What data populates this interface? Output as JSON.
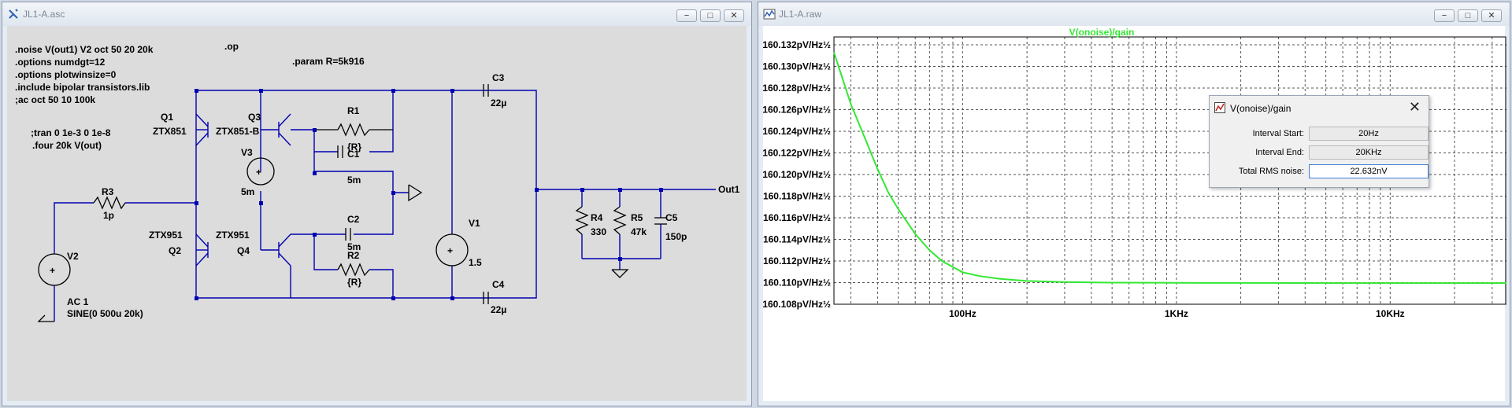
{
  "schematic_window": {
    "title": "JL1-A.asc",
    "controls": {
      "minimize": "−",
      "maximize": "□",
      "close": "✕"
    },
    "directives": [
      ".noise V(out1) V2 oct 50 20 20k",
      ".options numdgt=12",
      ".options plotwinsize=0",
      ".include bipolar transistors.lib",
      ";ac oct 50 10 100k"
    ],
    "directives2": [
      ";tran 0 1e-3 0 1e-8",
      ".four 20k V(out)"
    ],
    "op": ".op",
    "param": ".param R=5k916",
    "components": {
      "q1": "Q1",
      "q1_model": "ZTX851",
      "q3": "Q3",
      "q3_model": "ZTX851-B",
      "q2": "Q2",
      "q2_model": "ZTX951",
      "q4": "Q4",
      "q4_model": "ZTX951",
      "r1": "R1",
      "r1_val": "{R}",
      "r2": "R2",
      "r2_val": "{R}",
      "r3": "R3",
      "r3_val": "1p",
      "r4": "R4",
      "r4_val": "330",
      "r5": "R5",
      "r5_val": "47k",
      "c1": "C1",
      "c1_val": "5m",
      "c2": "C2",
      "c2_val": "5m",
      "c3": "C3",
      "c3_val": "22µ",
      "c4": "C4",
      "c4_val": "22µ",
      "c5": "C5",
      "c5_val": "150p",
      "v1": "V1",
      "v1_val": "1.5",
      "v2": "V2",
      "v2_ac": "AC 1",
      "v2_sine": "SINE(0 500u 20k)",
      "v3": "V3",
      "v3_val": "5m",
      "out": "Out1"
    }
  },
  "plot_window": {
    "title": "JL1-A.raw",
    "controls": {
      "minimize": "−",
      "maximize": "□",
      "close": "✕"
    },
    "trace_title": "V(onoise)/gain",
    "trace_color": "#33e833"
  },
  "chart_data": {
    "type": "line",
    "title": "V(onoise)/gain",
    "x_scale": "log",
    "xlim": [
      25,
      35000
    ],
    "x_ticks": [
      "100Hz",
      "1KHz",
      "10KHz"
    ],
    "y_ticks": [
      "160.132pV/Hz½",
      "160.130pV/Hz½",
      "160.128pV/Hz½",
      "160.126pV/Hz½",
      "160.124pV/Hz½",
      "160.122pV/Hz½",
      "160.120pV/Hz½",
      "160.118pV/Hz½",
      "160.116pV/Hz½",
      "160.114pV/Hz½",
      "160.112pV/Hz½",
      "160.110pV/Hz½",
      "160.108pV/Hz½"
    ],
    "ylim": [
      160.108,
      160.1325
    ],
    "grid": true,
    "series": [
      {
        "name": "V(onoise)/gain",
        "x": [
          25,
          30,
          35,
          40,
          45,
          50,
          60,
          70,
          80,
          100,
          120,
          150,
          200,
          300,
          500,
          1000,
          2000,
          5000,
          10000,
          35000
        ],
        "y": [
          160.1313,
          160.1265,
          160.1233,
          160.1205,
          160.1183,
          160.1168,
          160.1145,
          160.113,
          160.112,
          160.11095,
          160.1106,
          160.11035,
          160.11015,
          160.11005,
          160.11,
          160.10998,
          160.10997,
          160.10996,
          160.10996,
          160.10996
        ]
      }
    ]
  },
  "noise_dialog": {
    "title": "V(onoise)/gain",
    "close": "✕",
    "interval_start_label": "Interval Start:",
    "interval_start": "20Hz",
    "interval_end_label": "Interval End:",
    "interval_end": "20KHz",
    "rms_label": "Total RMS noise:",
    "rms_value": "22.632nV"
  }
}
